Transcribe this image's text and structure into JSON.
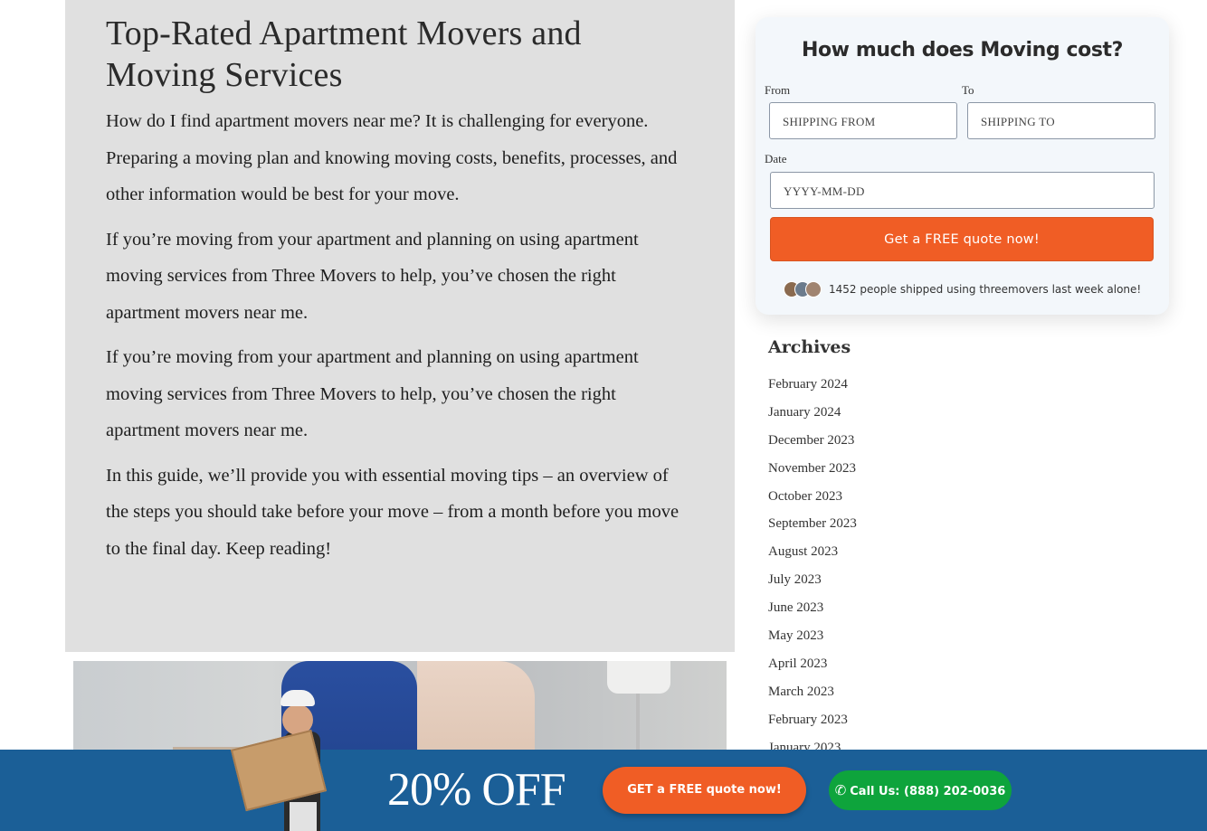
{
  "article": {
    "title": "Top-Rated Apartment Movers and Moving Services",
    "paragraphs": [
      "How do I find apartment movers near me? It is challenging for everyone. Preparing a moving plan and knowing moving costs, benefits, processes, and other information would be best for your move.",
      "If you’re moving from your apartment and planning on using apartment moving services from Three Movers to help, you’ve chosen the right apartment movers near me.",
      "If you’re moving from your apartment and planning on using apartment moving services from Three Movers to help, you’ve chosen the right apartment movers near me.",
      "In this guide, we’ll provide you with essential moving tips – an overview of the steps you should take before your move – from a month before you move to the final day. Keep reading!"
    ]
  },
  "quote_widget": {
    "title": "How much does Moving cost?",
    "from_label": "From",
    "to_label": "To",
    "date_label": "Date",
    "from_placeholder": "SHIPPING FROM",
    "to_placeholder": "SHIPPING TO",
    "date_placeholder": "YYYY-MM-DD",
    "cta_label": "Get a FREE quote now!",
    "social_proof": "1452 people shipped using threemovers last week alone!"
  },
  "archives": {
    "title": "Archives",
    "items": [
      "February 2024",
      "January 2024",
      "December 2023",
      "November 2023",
      "October 2023",
      "September 2023",
      "August 2023",
      "July 2023",
      "June 2023",
      "May 2023",
      "April 2023",
      "March 2023",
      "February 2023",
      "January 2023"
    ]
  },
  "promo_bar": {
    "discount": "20% OFF",
    "quote_button": "GET a FREE quote now!",
    "call_button": "Call Us: (888) 202-0036",
    "colors": {
      "bar": "#1b5f97",
      "orange": "#f05d25",
      "green": "#0ea43c"
    }
  }
}
